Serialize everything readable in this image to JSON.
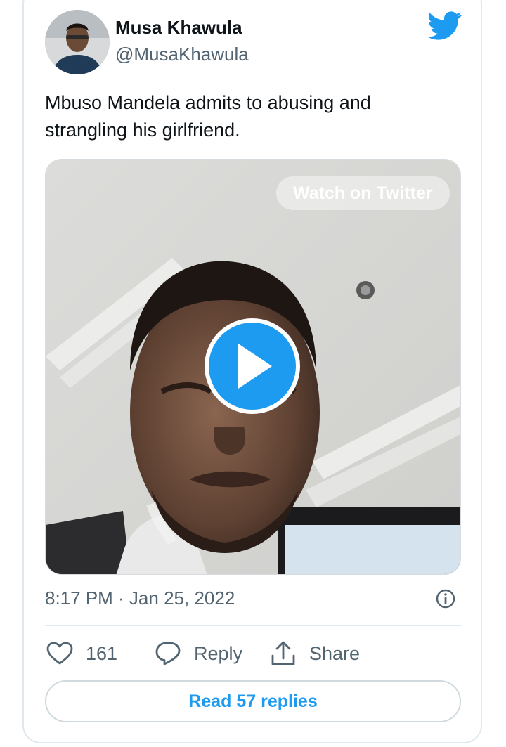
{
  "tweet": {
    "author": {
      "display_name": "Musa Khawula",
      "handle": "@MusaKhawula"
    },
    "text": "Mbuso Mandela admits to abusing and strangling his girlfriend.",
    "media": {
      "watch_label": "Watch on Twitter"
    },
    "timestamp": "8:17 PM · Jan 25, 2022",
    "actions": {
      "likes": "161",
      "reply_label": "Reply",
      "share_label": "Share"
    },
    "read_replies_label": "Read 57 replies"
  },
  "icons": {
    "brand": "twitter-bird-icon",
    "like": "heart-icon",
    "reply": "speech-bubble-icon",
    "share": "share-upload-icon",
    "info": "info-icon",
    "play": "play-icon"
  },
  "colors": {
    "accent": "#1d9bf0",
    "text_primary": "#0f1419",
    "text_secondary": "#536471",
    "border": "#e1e8ed"
  }
}
